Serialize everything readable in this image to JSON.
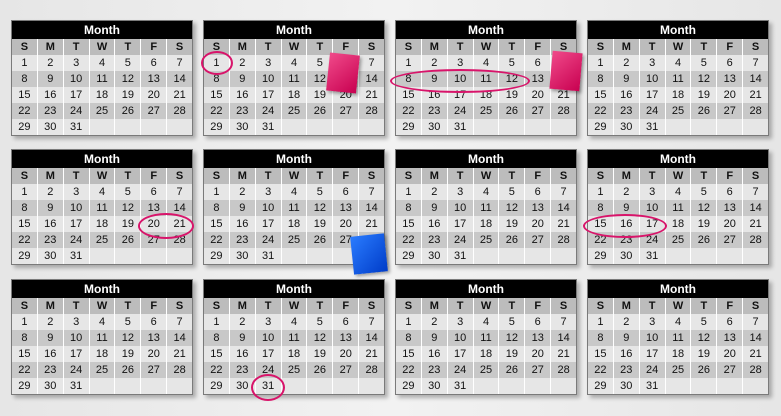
{
  "calendar": {
    "title": "Month",
    "weekdays": [
      "S",
      "M",
      "T",
      "W",
      "T",
      "F",
      "S"
    ],
    "weeks": [
      [
        "1",
        "2",
        "3",
        "4",
        "5",
        "6",
        "7"
      ],
      [
        "8",
        "9",
        "10",
        "11",
        "12",
        "13",
        "14"
      ],
      [
        "15",
        "16",
        "17",
        "18",
        "19",
        "20",
        "21"
      ],
      [
        "22",
        "23",
        "24",
        "25",
        "26",
        "27",
        "28"
      ],
      [
        "29",
        "30",
        "31",
        "",
        "",
        "",
        ""
      ]
    ]
  },
  "colors": {
    "highlight_circle": "#d8146a",
    "sticky_note_pink": "#e0106a",
    "sticky_note_blue": "#0a50e8"
  }
}
